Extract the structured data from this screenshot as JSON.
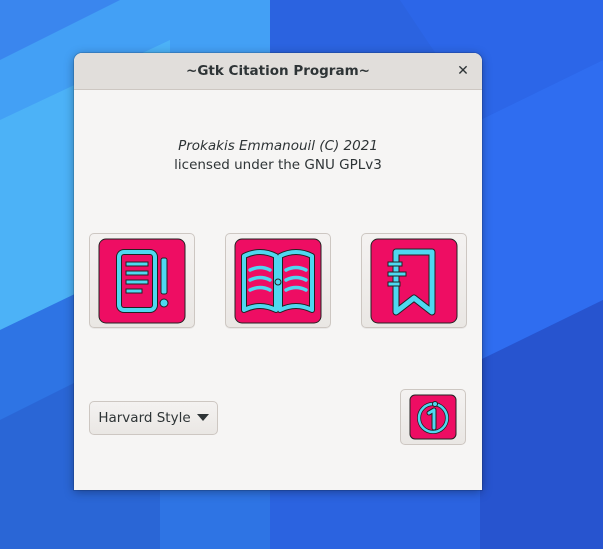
{
  "window": {
    "title": "~Gtk Citation Program~",
    "close_glyph": "✕"
  },
  "credits": {
    "author": "Prokakis Emmanouil (C) 2021",
    "license": "licensed under the GNU GPLv3"
  },
  "actions": [
    {
      "icon": "document-icon"
    },
    {
      "icon": "open-book-icon"
    },
    {
      "icon": "bookmark-icon"
    }
  ],
  "style_selector": {
    "selected": "Harvard Style"
  },
  "about_button": {
    "icon": "info-icon"
  },
  "colors": {
    "accent_pink": "#ee0d63",
    "accent_cyan": "#4fd8f0",
    "desktop_blue": "#2f6fe0"
  }
}
